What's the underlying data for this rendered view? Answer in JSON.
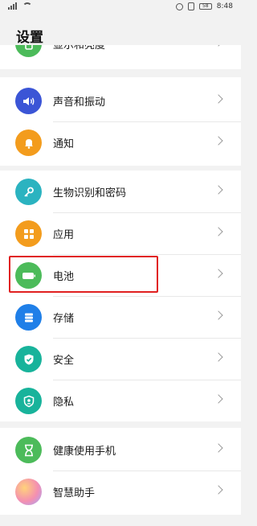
{
  "status": {
    "time": "8:48",
    "battery": "58"
  },
  "page": {
    "title": "设置"
  },
  "items": [
    {
      "label": "显示和亮度",
      "color": "#4cbb5a",
      "icon": "display-icon"
    },
    {
      "label": "声音和振动",
      "color": "#3b55d6",
      "icon": "sound-icon"
    },
    {
      "label": "通知",
      "color": "#f39c1d",
      "icon": "bell-icon"
    },
    {
      "label": "生物识别和密码",
      "color": "#2bb3c0",
      "icon": "key-icon"
    },
    {
      "label": "应用",
      "color": "#f39c1d",
      "icon": "apps-icon"
    },
    {
      "label": "电池",
      "color": "#4cbb5a",
      "icon": "battery-icon"
    },
    {
      "label": "存储",
      "color": "#1f7fe8",
      "icon": "storage-icon"
    },
    {
      "label": "安全",
      "color": "#18b39b",
      "icon": "shield-icon"
    },
    {
      "label": "隐私",
      "color": "#18b39b",
      "icon": "privacy-icon"
    },
    {
      "label": "健康使用手机",
      "color": "#4cbb5a",
      "icon": "hourglass-icon"
    },
    {
      "label": "智慧助手",
      "color": "#f4a4c4",
      "icon": "assistant-icon"
    }
  ]
}
